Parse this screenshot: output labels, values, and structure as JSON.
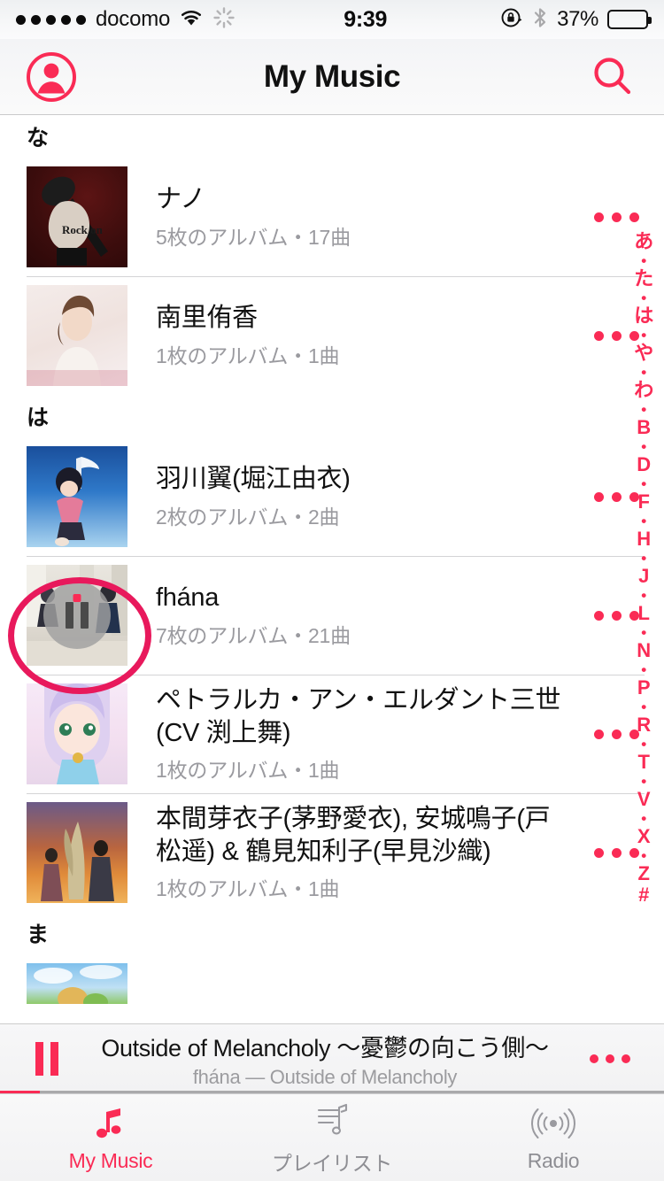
{
  "status_bar": {
    "signal_dots": 5,
    "carrier": "docomo",
    "wifi_icon": "wifi-icon",
    "activity_icon": "network-activity-spinner-icon",
    "time": "9:39",
    "rotation_lock_icon": "rotation-lock-icon",
    "bluetooth_icon": "bluetooth-icon",
    "battery_percent": "37%",
    "battery_level": 37
  },
  "nav": {
    "profile_icon": "profile-avatar-icon",
    "title": "My Music",
    "search_icon": "search-icon"
  },
  "colors": {
    "accent": "#fa2b55",
    "annotation": "#e8195c",
    "secondary_text": "#9a9a9f",
    "separator": "#d4d4d6"
  },
  "list": {
    "sections": [
      {
        "header": "な",
        "rows": [
          {
            "title": "ナノ",
            "subtitle": "5枚のアルバム・17曲",
            "art": "art-nano",
            "now_playing": false
          },
          {
            "title": "南里侑香",
            "subtitle": "1枚のアルバム・1曲",
            "art": "art-nanri",
            "now_playing": false
          }
        ]
      },
      {
        "header": "は",
        "rows": [
          {
            "title": "羽川翼(堀江由衣)",
            "subtitle": "2枚のアルバム・2曲",
            "art": "art-hanekawa",
            "now_playing": false
          },
          {
            "title": "fhána",
            "subtitle": "7枚のアルバム・21曲",
            "art": "art-fhana",
            "now_playing": true
          },
          {
            "title": "ペトラルカ・アン・エルダント三世 (CV 渕上舞)",
            "subtitle": "1枚のアルバム・1曲",
            "art": "art-petralka",
            "now_playing": false
          },
          {
            "title": "本間芽衣子(茅野愛衣), 安城鳴子(戸松遥) & 鶴見知利子(早見沙織)",
            "subtitle": "1枚のアルバム・1曲",
            "art": "art-honma",
            "now_playing": false
          }
        ]
      },
      {
        "header": "ま",
        "rows": [
          {
            "title": "",
            "subtitle": "",
            "art": "art-ma-partial",
            "now_playing": false
          }
        ]
      }
    ],
    "row_menu_icon": "more-options-ellipsis-icon"
  },
  "index_strip": [
    "あ",
    "•",
    "た",
    "•",
    "は",
    "•",
    "や",
    "•",
    "わ",
    "•",
    "B",
    "•",
    "D",
    "•",
    "F",
    "•",
    "H",
    "•",
    "J",
    "•",
    "L",
    "•",
    "N",
    "•",
    "P",
    "•",
    "R",
    "•",
    "T",
    "•",
    "V",
    "•",
    "X",
    "•",
    "Z",
    "#"
  ],
  "mini_player": {
    "pause_icon": "pause-icon",
    "track_title": "Outside of Melancholy 〜憂鬱の向こう側〜",
    "track_subtitle": "fhána — Outside of Melancholy",
    "menu_icon": "more-options-ellipsis-icon",
    "progress_percent": 6
  },
  "tab_bar": {
    "tabs": [
      {
        "label": "My Music",
        "icon": "music-note-icon",
        "active": true
      },
      {
        "label": "プレイリスト",
        "icon": "playlist-icon",
        "active": false
      },
      {
        "label": "Radio",
        "icon": "radio-broadcast-icon",
        "active": false
      }
    ]
  }
}
